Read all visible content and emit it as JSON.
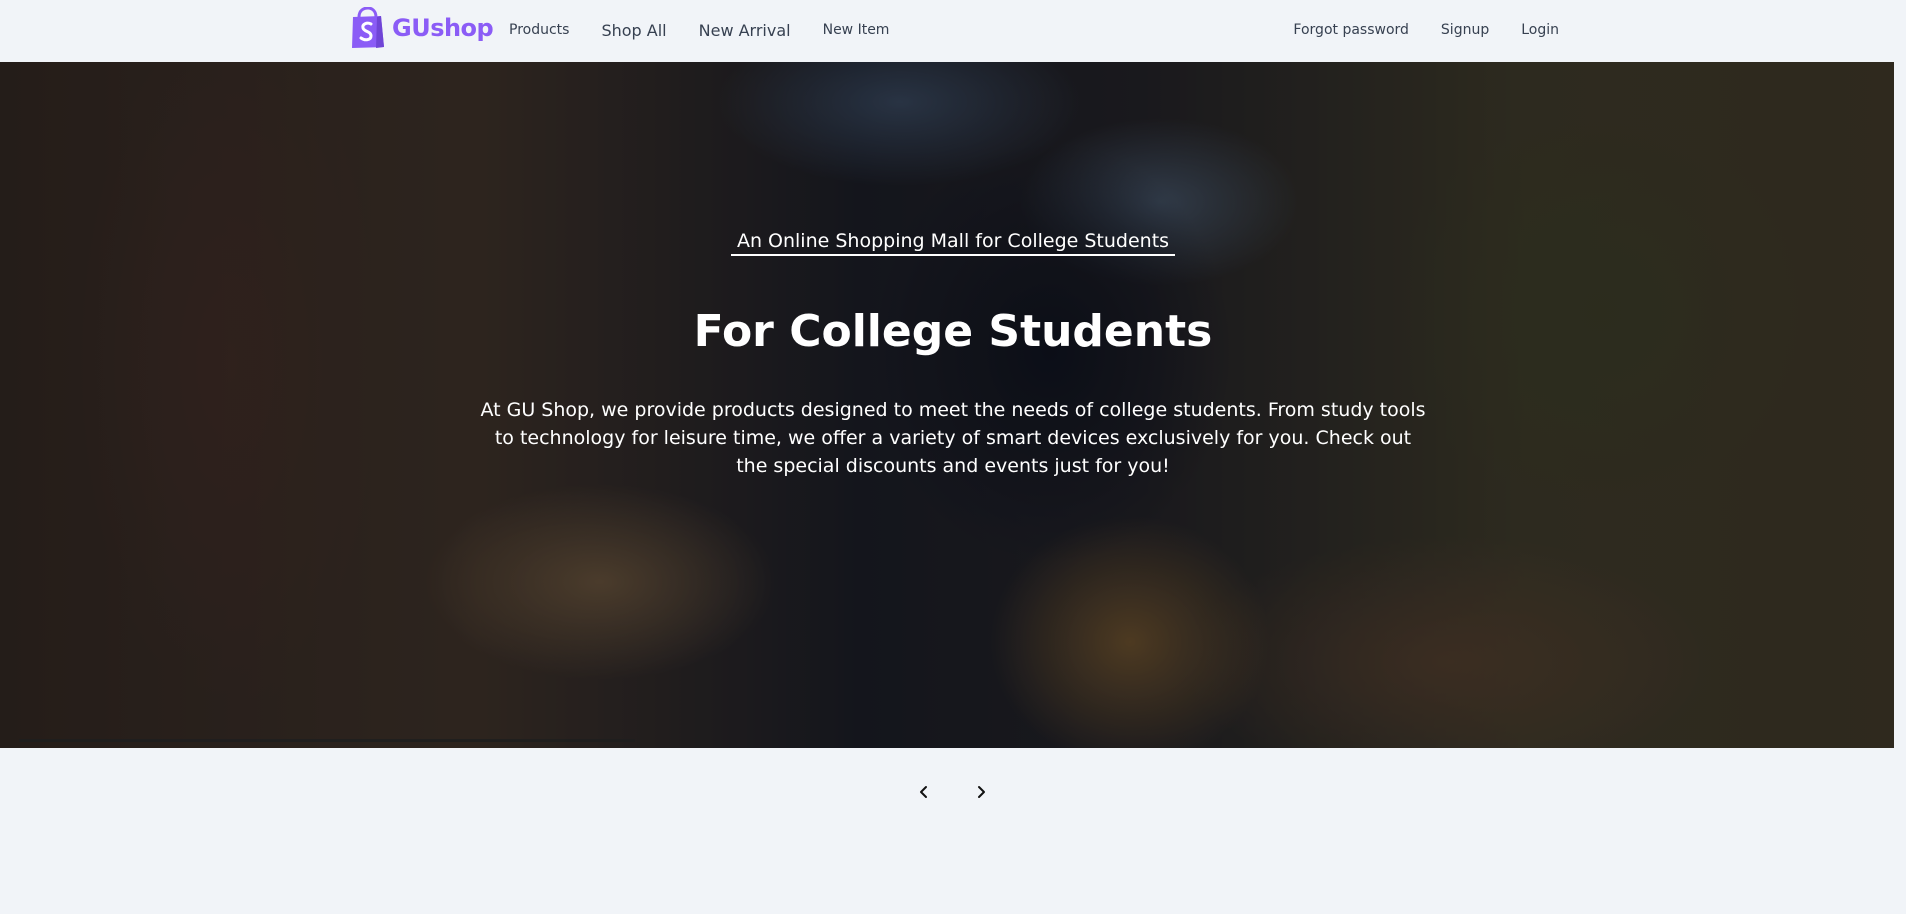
{
  "header": {
    "logo_text": "GUshop",
    "nav_left": [
      {
        "label": "Products",
        "size": "sm"
      },
      {
        "label": "Shop All",
        "size": "lg"
      },
      {
        "label": "New Arrival",
        "size": "lg"
      },
      {
        "label": "New Item",
        "size": "sm"
      }
    ],
    "nav_right": [
      {
        "label": "Forgot password"
      },
      {
        "label": "Signup"
      },
      {
        "label": "Login"
      }
    ]
  },
  "hero": {
    "subtitle": "An Online Shopping Mall for College Students",
    "title": "For College Students",
    "description": "At GU Shop, we provide products designed to meet the needs of college students. From study tools to technology for leisure time, we offer a variety of smart devices exclusively for you. Check out the special discounts and events just for you!",
    "slide_progress": 0.33
  },
  "carousel": {
    "prev_icon": "chevron-left-icon",
    "next_icon": "chevron-right-icon"
  },
  "colors": {
    "brand": "#8b5cf6",
    "background": "#f1f4f8",
    "nav_text": "#374151"
  }
}
